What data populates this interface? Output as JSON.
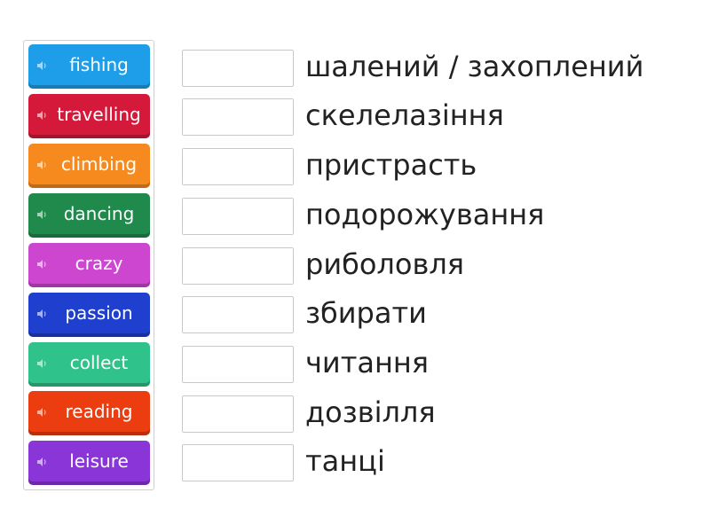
{
  "tiles": [
    {
      "label": "fishing",
      "color": "#1e9ee8",
      "icon": "speaker-icon"
    },
    {
      "label": "travelling",
      "color": "#d4193a",
      "icon": "speaker-icon"
    },
    {
      "label": "climbing",
      "color": "#f68a1e",
      "icon": "speaker-icon"
    },
    {
      "label": "dancing",
      "color": "#1f8a4c",
      "icon": "speaker-icon"
    },
    {
      "label": "crazy",
      "color": "#cc46d0",
      "icon": "speaker-icon"
    },
    {
      "label": "passion",
      "color": "#1f3fcf",
      "icon": "speaker-icon"
    },
    {
      "label": "collect",
      "color": "#2fc28a",
      "icon": "speaker-icon"
    },
    {
      "label": "reading",
      "color": "#ec3d10",
      "icon": "speaker-icon"
    },
    {
      "label": "leisure",
      "color": "#8a35d8",
      "icon": "speaker-icon"
    }
  ],
  "definitions": [
    "шалений / захоплений",
    "скелелазіння",
    "пристрасть",
    "подорожування",
    "риболовля",
    "збирати",
    "читання",
    "дозвілля",
    "танці"
  ]
}
